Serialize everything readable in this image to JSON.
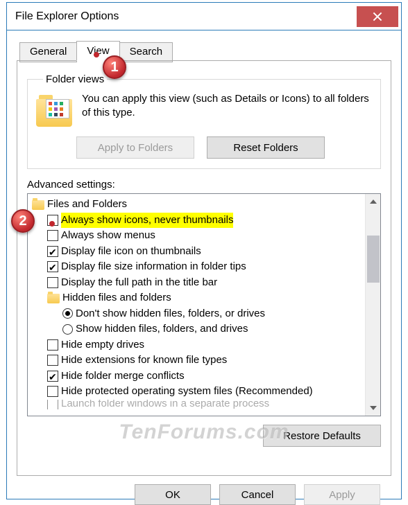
{
  "window": {
    "title": "File Explorer Options"
  },
  "tabs": {
    "general": "General",
    "view": "View",
    "search": "Search",
    "active": "view"
  },
  "folder_views": {
    "legend": "Folder views",
    "description": "You can apply this view (such as Details or Icons) to all folders of this type.",
    "apply_btn": "Apply to Folders",
    "reset_btn": "Reset Folders"
  },
  "advanced": {
    "label": "Advanced settings:",
    "root": "Files and Folders",
    "items": [
      {
        "type": "checkbox",
        "checked": false,
        "label": "Always show icons, never thumbnails",
        "highlight": true
      },
      {
        "type": "checkbox",
        "checked": false,
        "label": "Always show menus"
      },
      {
        "type": "checkbox",
        "checked": true,
        "label": "Display file icon on thumbnails"
      },
      {
        "type": "checkbox",
        "checked": true,
        "label": "Display file size information in folder tips"
      },
      {
        "type": "checkbox",
        "checked": false,
        "label": "Display the full path in the title bar"
      },
      {
        "type": "folder",
        "label": "Hidden files and folders"
      },
      {
        "type": "radio",
        "selected": true,
        "label": "Don't show hidden files, folders, or drives"
      },
      {
        "type": "radio",
        "selected": false,
        "label": "Show hidden files, folders, and drives"
      },
      {
        "type": "checkbox",
        "checked": false,
        "label": "Hide empty drives"
      },
      {
        "type": "checkbox",
        "checked": false,
        "label": "Hide extensions for known file types"
      },
      {
        "type": "checkbox",
        "checked": true,
        "label": "Hide folder merge conflicts"
      },
      {
        "type": "checkbox",
        "checked": false,
        "label": "Hide protected operating system files (Recommended)"
      },
      {
        "type": "checkbox",
        "checked": false,
        "label": "Launch folder windows in a separate process",
        "cut": true
      }
    ],
    "restore_btn": "Restore Defaults"
  },
  "dialog_buttons": {
    "ok": "OK",
    "cancel": "Cancel",
    "apply": "Apply"
  },
  "watermark": "TenForums.com",
  "annotations": {
    "one": "1",
    "two": "2"
  }
}
